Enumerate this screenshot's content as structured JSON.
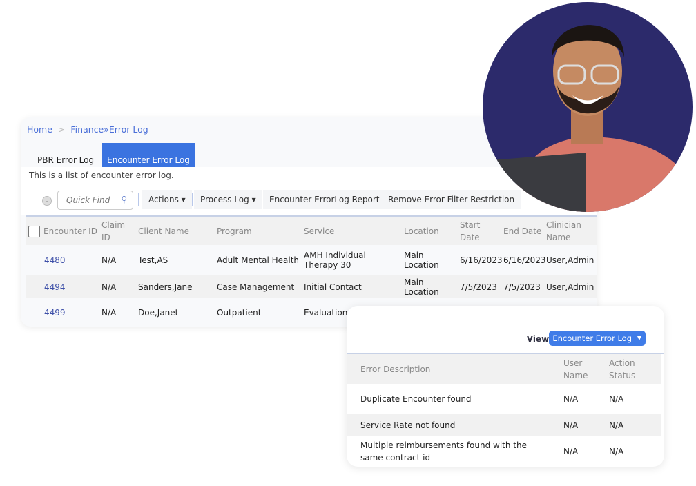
{
  "breadcrumb": {
    "home": "Home",
    "separator": ">",
    "section": "Finance",
    "current": "»Error Log"
  },
  "tabs": [
    {
      "label": "PBR Error Log",
      "active": false
    },
    {
      "label": "Encounter Error Log",
      "active": true
    }
  ],
  "description": "This is a list of encounter error log.",
  "toolbar": {
    "quick_find_placeholder": "Quick Find",
    "actions": "Actions ▾",
    "process_log": "Process Log ▾",
    "report": "Encounter ErrorLog Report",
    "remove_filter": "Remove Error Filter Restriction"
  },
  "encounters": {
    "columns": [
      "Encounter ID",
      "Claim ID",
      "Client Name",
      "Program",
      "Service",
      "Location",
      "Start Date",
      "End Date",
      "Clinician Name"
    ],
    "rows": [
      [
        "4480",
        "N/A",
        "Test,AS",
        "Adult Mental Health",
        "AMH Individual Therapy 30",
        "Main Location",
        "6/16/2023",
        "6/16/2023",
        "User,Admin"
      ],
      [
        "4494",
        "N/A",
        "Sanders,Jane",
        "Case Management",
        "Initial Contact",
        "Main Location",
        "7/5/2023",
        "7/5/2023",
        "User,Admin"
      ],
      [
        "4499",
        "N/A",
        "Doe,Janet",
        "Outpatient",
        "Evaluation",
        "",
        "",
        "",
        ""
      ]
    ]
  },
  "errors": {
    "view_label": "View:",
    "view_value": "Encounter Error Log",
    "columns": [
      "Error Description",
      "User Name",
      "Action Status"
    ],
    "rows": [
      [
        "Duplicate Encounter found",
        "N/A",
        "N/A"
      ],
      [
        "Service Rate not found",
        "N/A",
        "N/A"
      ],
      [
        "Multiple reimbursements found with the same contract id",
        "N/A",
        "N/A"
      ]
    ]
  },
  "colors": {
    "accent": "#3a73e0",
    "link": "#4a6fd8",
    "photo_bg": "#2c2a6b"
  }
}
